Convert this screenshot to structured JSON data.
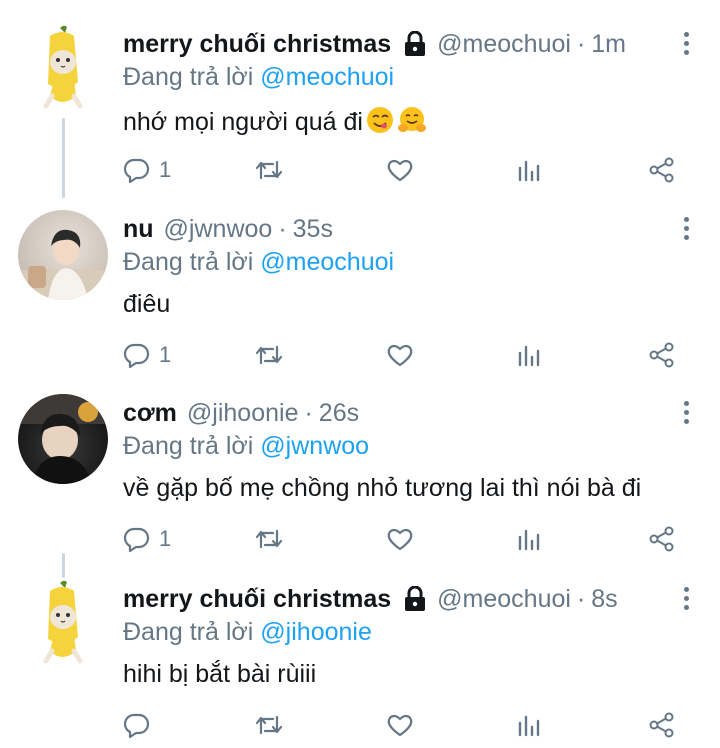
{
  "tweets": [
    {
      "display_name": "merry chuối christmas",
      "locked": true,
      "handle": "@meochuoi",
      "time": "1m",
      "reply_label": "Đang trả lời",
      "reply_to": "@meochuoi",
      "text": "nhớ mọi người quá đi",
      "emojis": [
        "yum-face",
        "hugging-face"
      ],
      "reply_count": "1",
      "avatar": "banana-cat"
    },
    {
      "display_name": "nu",
      "locked": false,
      "handle": "@jwnwoo",
      "time": "35s",
      "reply_label": "Đang trả lời",
      "reply_to": "@meochuoi",
      "text": "điêu",
      "emojis": [],
      "reply_count": "1",
      "avatar": "photo"
    },
    {
      "display_name": "cơm",
      "locked": false,
      "handle": "@jihoonie",
      "time": "26s",
      "reply_label": "Đang trả lời",
      "reply_to": "@jwnwoo",
      "text": "về gặp bố mẹ chồng nhỏ tương lai thì nói bà đi",
      "emojis": [],
      "reply_count": "1",
      "avatar": "photo-dark"
    },
    {
      "display_name": "merry chuối christmas",
      "locked": true,
      "handle": "@meochuoi",
      "time": "8s",
      "reply_label": "Đang trả lời",
      "reply_to": "@jihoonie",
      "text": "hihi bị bắt bài rùiii",
      "emojis": [],
      "reply_count": "",
      "avatar": "banana-cat"
    }
  ],
  "colors": {
    "text": "#14171a",
    "secondary": "#657786",
    "link": "#1da1f2",
    "thread_line": "#ccd6dd"
  },
  "separator": "·"
}
